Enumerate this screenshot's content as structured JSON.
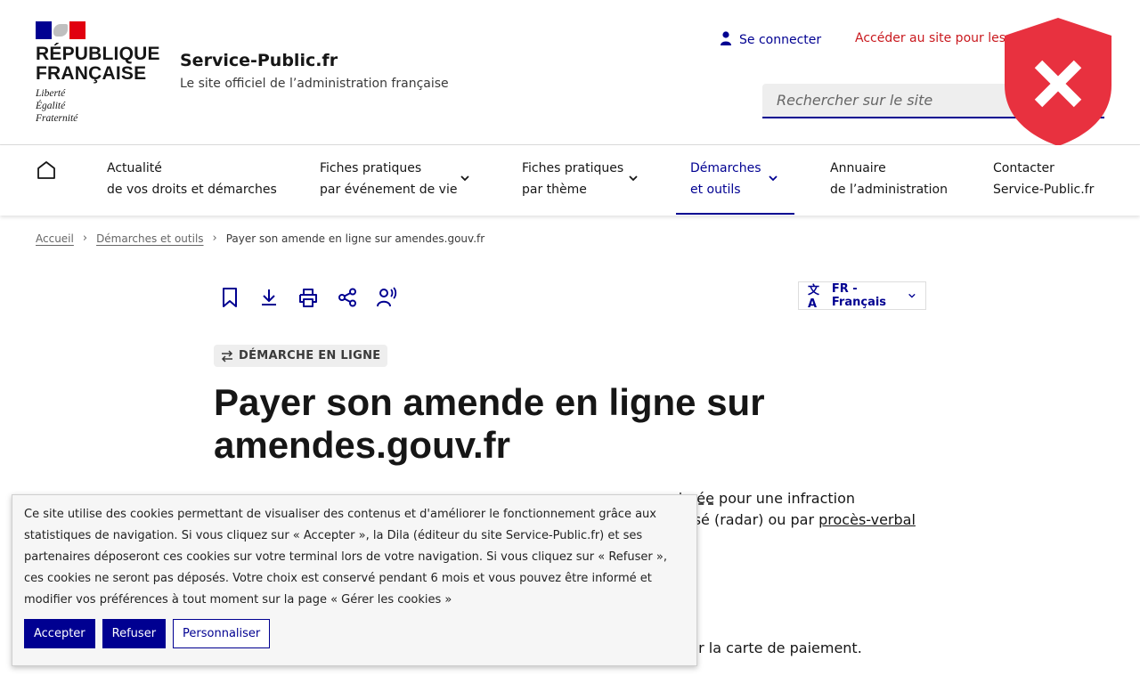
{
  "header": {
    "republique_title": "RÉPUBLIQUE\nFRANÇAISE",
    "motto": "Liberté\nÉgalité\nFraternité",
    "site_name": "Service-Public.fr",
    "tagline": "Le site officiel de l’administration française",
    "login_label": "Se connecter",
    "pro_link_label": "Accéder au site pour les",
    "search_placeholder": "Rechercher sur le site"
  },
  "nav": {
    "items": [
      {
        "line1": "Actualité",
        "line2": "de vos droits et démarches",
        "has_dropdown": false,
        "active": false
      },
      {
        "line1": "Fiches pratiques",
        "line2": "par événement de vie",
        "has_dropdown": true,
        "active": false
      },
      {
        "line1": "Fiches pratiques",
        "line2": "par thème",
        "has_dropdown": true,
        "active": false
      },
      {
        "line1": "Démarches",
        "line2": "et outils",
        "has_dropdown": true,
        "active": true
      },
      {
        "line1": "Annuaire",
        "line2": "de l’administration",
        "has_dropdown": false,
        "active": false
      },
      {
        "line1": "Contacter",
        "line2": "Service-Public.fr",
        "has_dropdown": false,
        "active": false
      }
    ]
  },
  "breadcrumb": {
    "items": [
      "Accueil",
      "Démarches et outils",
      "Payer son amende en ligne sur amendes.gouv.fr"
    ]
  },
  "toolbar": {
    "icons": [
      "bookmark-icon",
      "download-icon",
      "print-icon",
      "share-icon",
      "listen-icon"
    ],
    "language_label": "FR - Français"
  },
  "content": {
    "badge": "DÉMARCHE EN LIGNE",
    "title": "Payer son amende en ligne sur amendes.gouv.fr",
    "paragraph_visible_tail_1": "ajorée",
    "paragraph_visible_tail_2": " pour une infraction",
    "paragraph_visible_line2_a": "tisé (radar) ou par ",
    "paragraph_visible_line2_link": "procès-verbal",
    "paragraph2_visible": "ur la carte de paiement."
  },
  "cookie_banner": {
    "text": "Ce site utilise des cookies permettant de visualiser des contenus et d'améliorer le fonctionnement grâce aux statistiques de navigation. Si vous cliquez sur « Accepter », la Dila (éditeur du site Service-Public.fr) et ses partenaires déposeront ces cookies sur votre terminal lors de votre navigation. Si vous cliquez sur « Refuser », ces cookies ne seront pas déposés. Votre choix est conservé pendant 6 mois et vous pouvez être informé et modifier vos préférences à tout moment sur la page « Gérer les cookies »",
    "accept_label": "Accepter",
    "refuse_label": "Refuser",
    "customize_label": "Personnaliser"
  },
  "colors": {
    "primary_blue": "#000091",
    "marianne_red": "#e1000f",
    "alert_red": "#e8313f",
    "pro_link_red": "#c9191e"
  }
}
